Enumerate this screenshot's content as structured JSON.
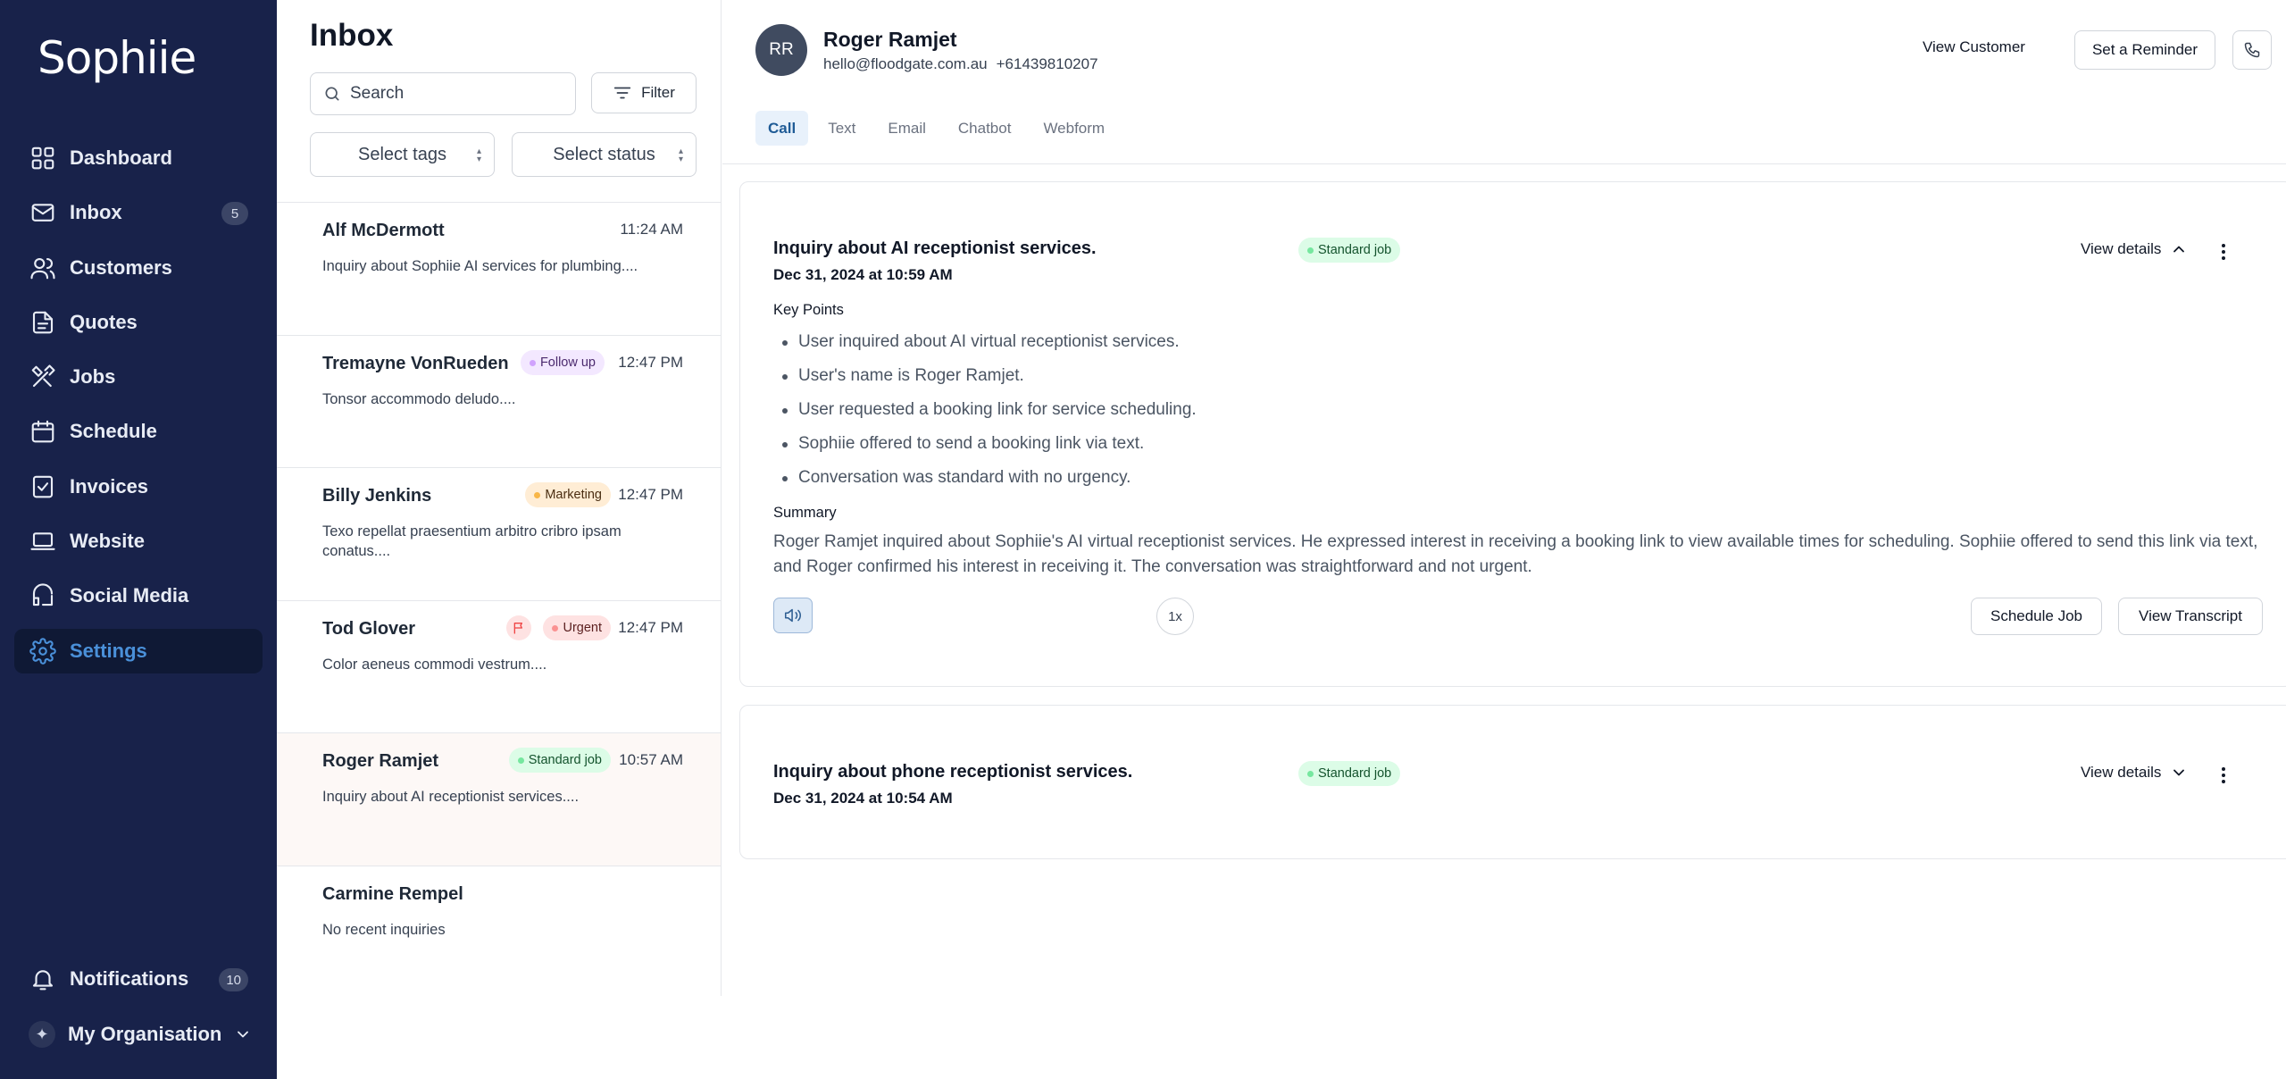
{
  "app": {
    "logo": "Sophiie"
  },
  "sidebar": {
    "items": [
      {
        "label": "Dashboard",
        "icon": "dashboard-icon"
      },
      {
        "label": "Inbox",
        "icon": "mail-icon",
        "badge": "5"
      },
      {
        "label": "Customers",
        "icon": "users-icon"
      },
      {
        "label": "Quotes",
        "icon": "document-icon"
      },
      {
        "label": "Jobs",
        "icon": "tools-icon"
      },
      {
        "label": "Schedule",
        "icon": "calendar-icon"
      },
      {
        "label": "Invoices",
        "icon": "invoice-check-icon"
      },
      {
        "label": "Website",
        "icon": "laptop-icon"
      },
      {
        "label": "Social Media",
        "icon": "megaphone-icon"
      },
      {
        "label": "Settings",
        "icon": "gear-icon",
        "active": true
      }
    ],
    "notifications": {
      "label": "Notifications",
      "badge": "10",
      "icon": "bell-icon"
    },
    "organisation": {
      "label": "My Organisation",
      "icon": "sparkle-icon"
    },
    "colors": {
      "background": "#18224a",
      "active_text": "#4a90d9"
    }
  },
  "inbox": {
    "title": "Inbox",
    "search_placeholder": "Search",
    "filter_label": "Filter",
    "select_tags": "Select tags",
    "select_status": "Select status",
    "conversations": [
      {
        "name": "Alf McDermott",
        "time": "11:24 AM",
        "preview": "Inquiry about Sophiie AI services for plumbing...."
      },
      {
        "name": "Tremayne VonRueden",
        "tag": "Follow up",
        "time": "12:47 PM",
        "preview": "Tonsor accommodo deludo...."
      },
      {
        "name": "Billy Jenkins",
        "tag": "Marketing",
        "time": "12:47 PM",
        "preview": "Texo repellat praesentium arbitro cribro ipsam conatus...."
      },
      {
        "name": "Tod Glover",
        "tag": "Urgent",
        "flagged": true,
        "time": "12:47 PM",
        "preview": "Color aeneus commodi vestrum...."
      },
      {
        "name": "Roger Ramjet",
        "tag": "Standard job",
        "time": "10:57 AM",
        "preview": "Inquiry about AI receptionist services....",
        "active": true
      },
      {
        "name": "Carmine Rempel",
        "time": "",
        "preview": "No recent inquiries"
      }
    ]
  },
  "detail": {
    "contact": {
      "initials": "RR",
      "name": "Roger Ramjet",
      "email": "hello@floodgate.com.au",
      "phone": "+61439810207"
    },
    "actions": {
      "view_customer": "View Customer",
      "set_reminder": "Set a Reminder"
    },
    "tabs": [
      "Call",
      "Text",
      "Email",
      "Chatbot",
      "Webform"
    ],
    "active_tab": "Call",
    "calls": [
      {
        "title": "Inquiry about AI receptionist services.",
        "date": "Dec 31, 2024 at 10:59 AM",
        "tag": "Standard job",
        "view_details": "View details",
        "expanded": true,
        "key_points_label": "Key Points",
        "key_points": [
          "User inquired about AI virtual receptionist services.",
          "User's name is Roger Ramjet.",
          "User requested a booking link for service scheduling.",
          "Sophiie offered to send a booking link via text.",
          "Conversation was standard with no urgency."
        ],
        "summary_label": "Summary",
        "summary": "Roger Ramjet inquired about Sophiie's AI virtual receptionist services. He expressed interest in receiving a booking link to view available times for scheduling. Sophiie offered to send this link via text, and Roger confirmed his interest in receiving it. The conversation was straightforward and not urgent.",
        "playback_speed": "1x",
        "schedule_job": "Schedule Job",
        "view_transcript": "View Transcript"
      },
      {
        "title": "Inquiry about phone receptionist services.",
        "date": "Dec 31, 2024 at 10:54 AM",
        "tag": "Standard job",
        "view_details": "View details",
        "expanded": false
      }
    ]
  }
}
